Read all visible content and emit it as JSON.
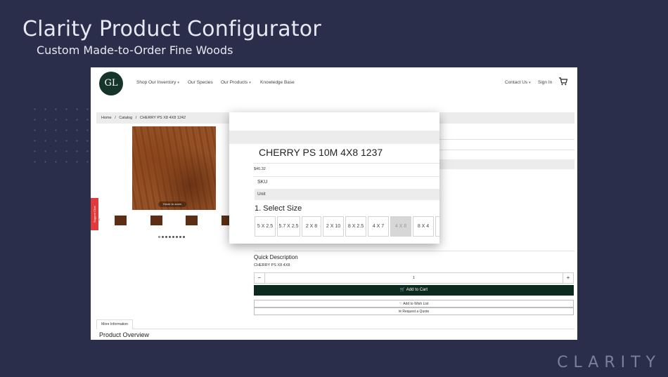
{
  "slide": {
    "title": "Clarity Product Configurator",
    "subtitle": "Custom Made-to-Order Fine Woods",
    "brand": "CLARITY"
  },
  "nav": {
    "logo_text": "GL",
    "items": [
      {
        "label": "Shop Our Inventory",
        "has_caret": true
      },
      {
        "label": "Our Species",
        "has_caret": false
      },
      {
        "label": "Our Products",
        "has_caret": true
      },
      {
        "label": "Knowledge Base",
        "has_caret": false
      }
    ],
    "contact_label": "Contact Us",
    "signin_label": "Sign In",
    "cart_icon": "cart-icon"
  },
  "breadcrumb": [
    "Home",
    "/",
    "Catalog",
    "/",
    "CHERRY PS X8 4X8 1242"
  ],
  "gallery": {
    "hover_label": "Hover to zoom",
    "support_tab": "Support Chat"
  },
  "popup": {
    "product_name": "CHERRY PS 10M 4X8 1237",
    "price": "$40.32",
    "sku_label": "SKU",
    "unit_label": "Unit",
    "select_size_label": "1. Select Size",
    "sizes": [
      "5 X 2.5",
      "5.7 X 2.5",
      "2 X 8",
      "2 X 10",
      "8 X 2.5",
      "4 X 7",
      "4 X 8",
      "8 X 4"
    ],
    "selected_size": "4 X 8"
  },
  "product": {
    "quick_description_title": "Quick Description",
    "quick_description_text": "CHERRY PS X8 4X8",
    "quantity": "1",
    "minus": "−",
    "plus": "+",
    "add_to_cart": "🛒 Add to Cart",
    "wish_list": "♡ Add to Wish List",
    "request_quote": "✉ Request a Quote"
  },
  "tabs": {
    "more_information": "More Information",
    "product_overview": "Product Overview"
  }
}
